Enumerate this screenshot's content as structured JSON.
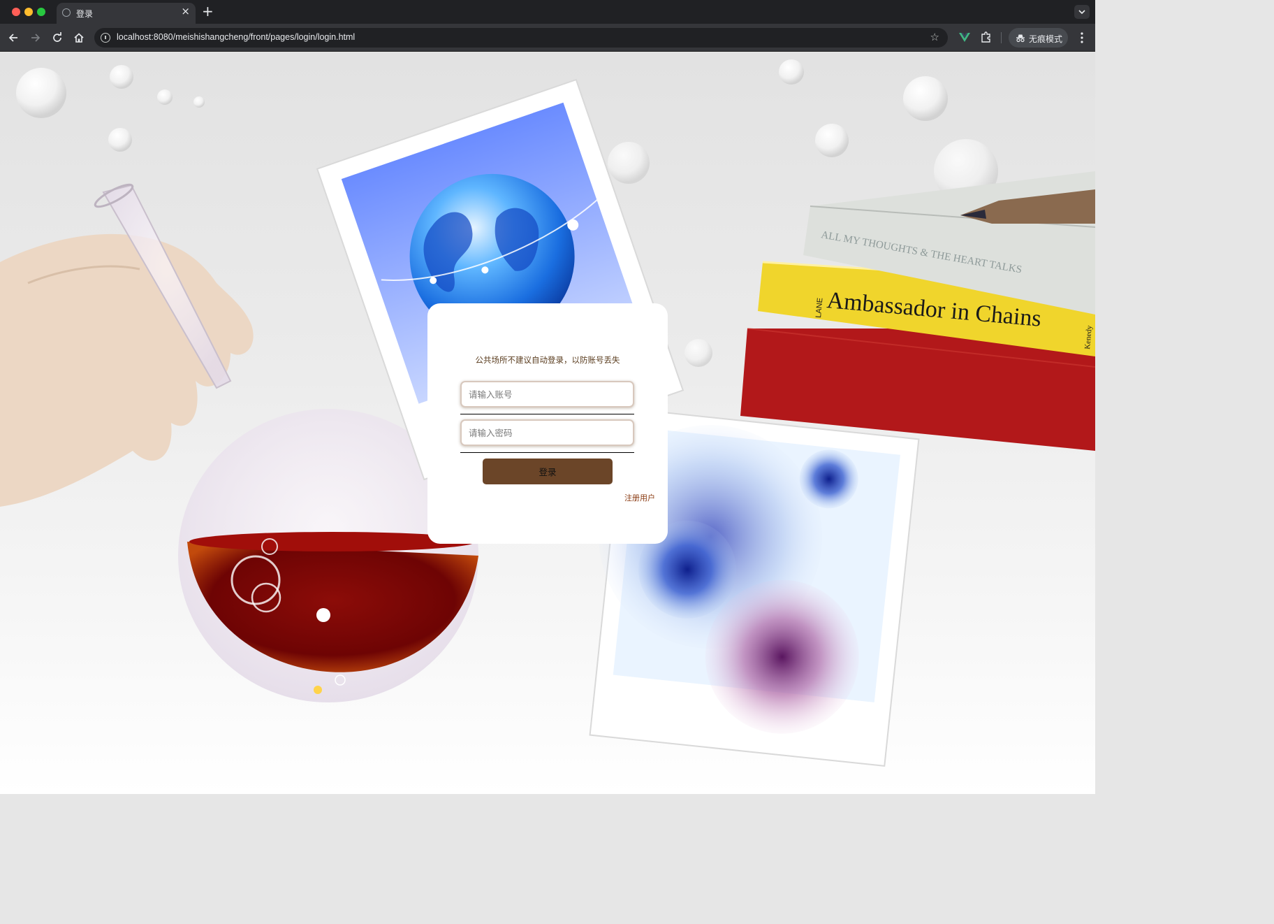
{
  "browser": {
    "tab_title": "登录",
    "tab_close": "×",
    "new_tab": "+",
    "url": "localhost:8080/meishishangcheng/front/pages/login/login.html",
    "star": "☆",
    "incognito_label": "无痕模式"
  },
  "login": {
    "notice": "公共场所不建议自动登录，以防账号丢失",
    "account_placeholder": "请输入账号",
    "password_placeholder": "请输入密码",
    "login_button": "登录",
    "register_link": "注册用户"
  },
  "background": {
    "book_spine_top": "ALL MY THOUGHTS & THE HEART TALKS",
    "book_spine_middle": "Ambassador in Chains",
    "book_spine_middle_side": "LANE",
    "book_spine_middle_author": "Kenedy"
  },
  "colors": {
    "login_button": "#6b4528",
    "register_link": "#8a3b12",
    "notice_text": "#5a3c1e"
  }
}
